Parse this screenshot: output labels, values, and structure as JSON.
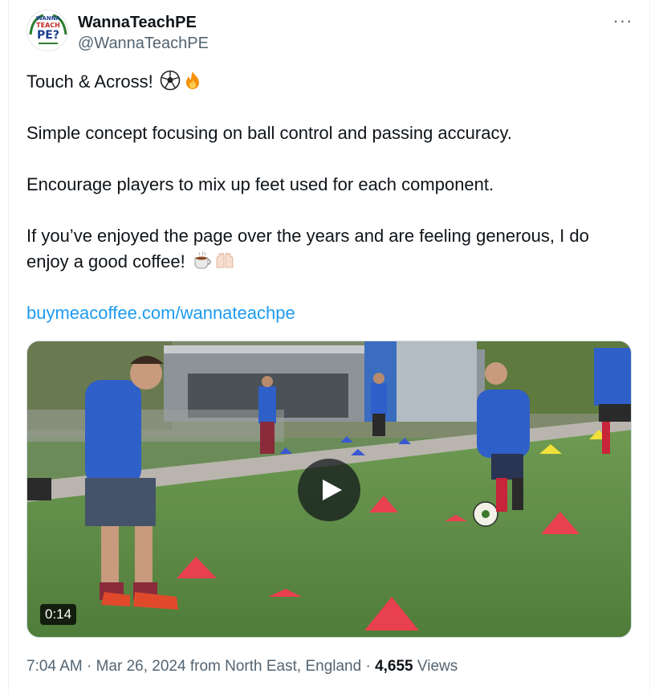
{
  "user": {
    "display_name": "WannaTeachPE",
    "handle": "@WannaTeachPE",
    "avatar_text": [
      "WANNA",
      "TEACH",
      "PE?"
    ]
  },
  "more_label": "···",
  "tweet": {
    "line1": "Touch & Across!",
    "line1_emojis": [
      "soccer-ball",
      "fire"
    ],
    "line2": "Simple concept focusing on ball control and passing accuracy.",
    "line3": "Encourage players to mix up feet used for each component.",
    "line4a": "If you’ve enjoyed the page over the years and are feeling generous, I do",
    "line4b": "enjoy a good coffee!",
    "line4_emojis": [
      "hot-beverage",
      "raising-hands"
    ],
    "link": "buymeacoffee.com/wannateachpe"
  },
  "media": {
    "duration": "0:14",
    "play_icon": "play-icon"
  },
  "footer": {
    "time": "7:04 AM",
    "date": "Mar 26, 2024",
    "location": "from North East, England",
    "views_count": "4,655",
    "views_label": "Views",
    "separator": "·"
  },
  "colors": {
    "link": "#1d9bf0",
    "secondary_text": "#536471",
    "primary_text": "#0f1419"
  }
}
